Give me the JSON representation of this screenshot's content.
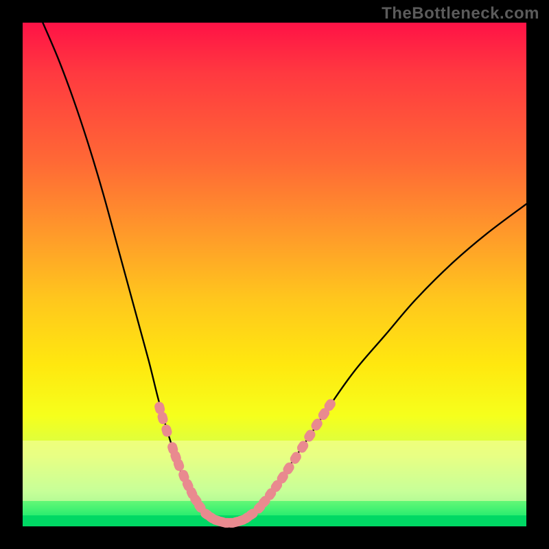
{
  "watermark": "TheBottleneck.com",
  "colors": {
    "top": "#ff1246",
    "mid": "#ffe80f",
    "bottom": "#00e56a",
    "pale_band": "#f9ffb0",
    "marker": "#e98a8f",
    "curve": "#000000",
    "frame": "#000000"
  },
  "chart_data": {
    "type": "line",
    "title": "",
    "xlabel": "",
    "ylabel": "",
    "xlim": [
      0,
      100
    ],
    "ylim": [
      0,
      100
    ],
    "curve": [
      {
        "x": 4,
        "y": 100
      },
      {
        "x": 7,
        "y": 93
      },
      {
        "x": 10,
        "y": 85
      },
      {
        "x": 13,
        "y": 76
      },
      {
        "x": 16,
        "y": 66
      },
      {
        "x": 19,
        "y": 55
      },
      {
        "x": 22,
        "y": 44
      },
      {
        "x": 25,
        "y": 33
      },
      {
        "x": 27,
        "y": 25
      },
      {
        "x": 29,
        "y": 18
      },
      {
        "x": 31,
        "y": 12
      },
      {
        "x": 33,
        "y": 7
      },
      {
        "x": 35,
        "y": 3.5
      },
      {
        "x": 37,
        "y": 1.6
      },
      {
        "x": 39,
        "y": 0.7
      },
      {
        "x": 41,
        "y": 0.5
      },
      {
        "x": 43,
        "y": 0.7
      },
      {
        "x": 45,
        "y": 1.6
      },
      {
        "x": 47,
        "y": 3.5
      },
      {
        "x": 50,
        "y": 7
      },
      {
        "x": 53,
        "y": 12
      },
      {
        "x": 57,
        "y": 18
      },
      {
        "x": 61,
        "y": 24
      },
      {
        "x": 66,
        "y": 31
      },
      {
        "x": 72,
        "y": 38
      },
      {
        "x": 78,
        "y": 45
      },
      {
        "x": 85,
        "y": 52
      },
      {
        "x": 92,
        "y": 58
      },
      {
        "x": 100,
        "y": 64
      }
    ],
    "markers_left": [
      {
        "x": 27.2,
        "y": 23.5
      },
      {
        "x": 27.8,
        "y": 21.5
      },
      {
        "x": 28.6,
        "y": 19.0
      },
      {
        "x": 29.8,
        "y": 15.5
      },
      {
        "x": 30.4,
        "y": 13.8
      },
      {
        "x": 31.0,
        "y": 12.2
      },
      {
        "x": 32.0,
        "y": 10.0
      },
      {
        "x": 32.8,
        "y": 8.2
      },
      {
        "x": 33.6,
        "y": 6.6
      },
      {
        "x": 34.4,
        "y": 5.2
      },
      {
        "x": 35.2,
        "y": 3.9
      }
    ],
    "markers_bottom": [
      {
        "x": 36.5,
        "y": 2.4
      },
      {
        "x": 37.5,
        "y": 1.7
      },
      {
        "x": 38.5,
        "y": 1.2
      },
      {
        "x": 39.5,
        "y": 0.9
      },
      {
        "x": 40.5,
        "y": 0.7
      },
      {
        "x": 41.5,
        "y": 0.7
      },
      {
        "x": 42.5,
        "y": 0.9
      },
      {
        "x": 43.5,
        "y": 1.2
      },
      {
        "x": 44.5,
        "y": 1.7
      },
      {
        "x": 45.5,
        "y": 2.4
      }
    ],
    "markers_right": [
      {
        "x": 47.0,
        "y": 3.7
      },
      {
        "x": 48.0,
        "y": 4.9
      },
      {
        "x": 49.2,
        "y": 6.4
      },
      {
        "x": 50.4,
        "y": 8.0
      },
      {
        "x": 51.6,
        "y": 9.7
      },
      {
        "x": 52.8,
        "y": 11.5
      },
      {
        "x": 54.2,
        "y": 13.6
      },
      {
        "x": 55.6,
        "y": 15.8
      },
      {
        "x": 57.0,
        "y": 18.0
      },
      {
        "x": 58.4,
        "y": 20.2
      },
      {
        "x": 59.8,
        "y": 22.3
      },
      {
        "x": 61.0,
        "y": 24.1
      }
    ],
    "bands": [
      {
        "name": "pale-yellow",
        "y_from": 17,
        "y_to": 5,
        "color": "#f9ffb0"
      },
      {
        "name": "green-solid",
        "y_from": 2,
        "y_to": 0,
        "color": "#00d864"
      }
    ],
    "legend": [],
    "grid": false,
    "annotations": []
  }
}
